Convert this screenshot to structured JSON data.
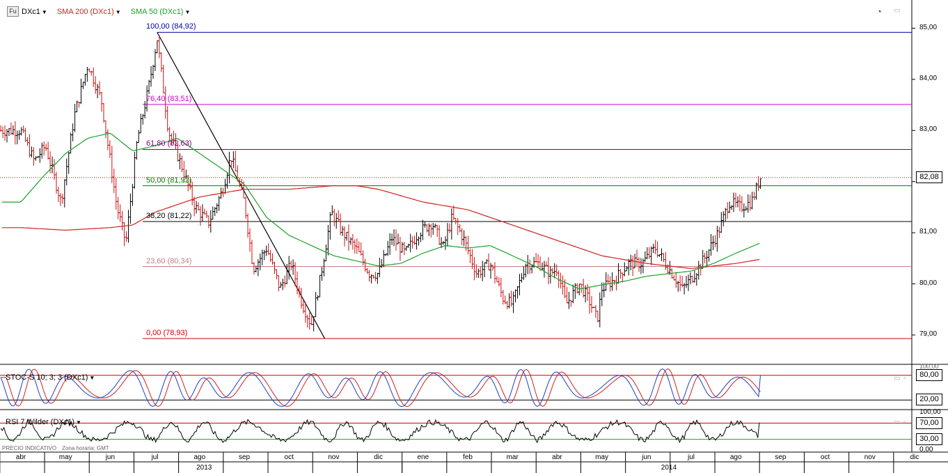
{
  "header": {
    "badge": "Fu",
    "symbol": "DXc1",
    "sma200_label": "SMA 200 (DXc1)",
    "sma50_label": "SMA 50 (DXc1)",
    "stoch_label": "STOC-S 10; 3; 3 (DXc1)",
    "rsi_label": "RSI 7 Wilder (DXc1)"
  },
  "footer_note": "PRECIO INDICATIVO",
  "footer_tz": "Zona horaria: GMT",
  "colors": {
    "sma200": "#d21f1f",
    "sma50": "#1aa12a",
    "stoch_k": "#1f3fbf",
    "stoch_d": "#d21f1f",
    "bar_up": "#000000",
    "bar_down": "#cc1010",
    "fib_100": "#0000aa",
    "fib_764": "#cc00cc",
    "fib_618": "#800080",
    "fib_500": "#007a00",
    "fib_382": "#000000",
    "fib_236": "#c48080",
    "fib_000": "#cc0000"
  },
  "chart_data": {
    "type": "ohlc",
    "symbol": "DXc1",
    "y_ticks": [
      "85,00",
      "84,00",
      "83,00",
      "82,00",
      "81,00",
      "80,00",
      "79,00"
    ],
    "y_tick_values": [
      85,
      84,
      83,
      82,
      81,
      80,
      79
    ],
    "ylim": [
      78.5,
      85.3
    ],
    "last_price": "82,08",
    "months": [
      "abr",
      "may",
      "jun",
      "jul",
      "ago",
      "sep",
      "oct",
      "nov",
      "dic",
      "ene",
      "feb",
      "mar",
      "abr",
      "may",
      "jun",
      "jul",
      "ago",
      "sep",
      "oct",
      "nov",
      "dic"
    ],
    "years": [
      "2013",
      "2014"
    ],
    "close_anchors": [
      {
        "m": 0.0,
        "v": 83.0
      },
      {
        "m": 0.3,
        "v": 82.4
      },
      {
        "m": 0.55,
        "v": 82.7
      },
      {
        "m": 0.9,
        "v": 81.6
      },
      {
        "m": 1.2,
        "v": 83.3
      },
      {
        "m": 1.5,
        "v": 84.3
      },
      {
        "m": 1.8,
        "v": 83.6
      },
      {
        "m": 2.15,
        "v": 81.5
      },
      {
        "m": 2.35,
        "v": 80.8
      },
      {
        "m": 2.6,
        "v": 82.8
      },
      {
        "m": 2.85,
        "v": 83.8
      },
      {
        "m": 3.05,
        "v": 84.8
      },
      {
        "m": 3.3,
        "v": 83.0
      },
      {
        "m": 3.6,
        "v": 82.3
      },
      {
        "m": 3.9,
        "v": 81.5
      },
      {
        "m": 4.2,
        "v": 81.2
      },
      {
        "m": 4.5,
        "v": 81.8
      },
      {
        "m": 4.7,
        "v": 82.5
      },
      {
        "m": 5.0,
        "v": 81.6
      },
      {
        "m": 5.2,
        "v": 80.3
      },
      {
        "m": 5.5,
        "v": 80.7
      },
      {
        "m": 5.8,
        "v": 79.9
      },
      {
        "m": 6.05,
        "v": 80.4
      },
      {
        "m": 6.3,
        "v": 79.6
      },
      {
        "m": 6.5,
        "v": 79.2
      },
      {
        "m": 6.7,
        "v": 80.1
      },
      {
        "m": 6.95,
        "v": 81.4
      },
      {
        "m": 7.2,
        "v": 81.0
      },
      {
        "m": 7.5,
        "v": 80.7
      },
      {
        "m": 7.8,
        "v": 80.2
      },
      {
        "m": 8.0,
        "v": 80.2
      },
      {
        "m": 8.3,
        "v": 80.9
      },
      {
        "m": 8.6,
        "v": 80.6
      },
      {
        "m": 8.9,
        "v": 81.0
      },
      {
        "m": 9.2,
        "v": 81.2
      },
      {
        "m": 9.45,
        "v": 80.7
      },
      {
        "m": 9.65,
        "v": 81.3
      },
      {
        "m": 9.9,
        "v": 80.9
      },
      {
        "m": 10.2,
        "v": 80.2
      },
      {
        "m": 10.5,
        "v": 80.4
      },
      {
        "m": 10.8,
        "v": 79.7
      },
      {
        "m": 11.0,
        "v": 79.6
      },
      {
        "m": 11.3,
        "v": 80.4
      },
      {
        "m": 11.6,
        "v": 80.4
      },
      {
        "m": 11.85,
        "v": 80.2
      },
      {
        "m": 12.0,
        "v": 80.3
      },
      {
        "m": 12.2,
        "v": 79.6
      },
      {
        "m": 12.5,
        "v": 80.0
      },
      {
        "m": 12.7,
        "v": 79.7
      },
      {
        "m": 12.9,
        "v": 79.3
      },
      {
        "m": 13.0,
        "v": 79.9
      },
      {
        "m": 13.3,
        "v": 80.1
      },
      {
        "m": 13.6,
        "v": 80.4
      },
      {
        "m": 13.9,
        "v": 80.4
      },
      {
        "m": 14.2,
        "v": 80.7
      },
      {
        "m": 14.5,
        "v": 80.3
      },
      {
        "m": 14.8,
        "v": 79.9
      },
      {
        "m": 15.0,
        "v": 80.1
      },
      {
        "m": 15.3,
        "v": 80.5
      },
      {
        "m": 15.6,
        "v": 81.0
      },
      {
        "m": 15.85,
        "v": 81.6
      },
      {
        "m": 16.1,
        "v": 81.5
      },
      {
        "m": 16.35,
        "v": 81.6
      },
      {
        "m": 16.55,
        "v": 82.08
      }
    ],
    "sma200_anchors": [
      {
        "m": 0.0,
        "v": 81.1
      },
      {
        "m": 1.0,
        "v": 81.05
      },
      {
        "m": 2.0,
        "v": 81.1
      },
      {
        "m": 2.5,
        "v": 81.15
      },
      {
        "m": 3.0,
        "v": 81.4
      },
      {
        "m": 4.0,
        "v": 81.7
      },
      {
        "m": 5.0,
        "v": 81.85
      },
      {
        "m": 6.0,
        "v": 81.85
      },
      {
        "m": 7.0,
        "v": 81.92
      },
      {
        "m": 7.5,
        "v": 81.92
      },
      {
        "m": 8.0,
        "v": 81.85
      },
      {
        "m": 9.0,
        "v": 81.6
      },
      {
        "m": 10.0,
        "v": 81.45
      },
      {
        "m": 11.0,
        "v": 81.15
      },
      {
        "m": 12.0,
        "v": 80.85
      },
      {
        "m": 13.0,
        "v": 80.55
      },
      {
        "m": 14.0,
        "v": 80.4
      },
      {
        "m": 15.0,
        "v": 80.3
      },
      {
        "m": 16.0,
        "v": 80.4
      },
      {
        "m": 16.55,
        "v": 80.48
      }
    ],
    "sma50_anchors": [
      {
        "m": 0.0,
        "v": 81.6
      },
      {
        "m": 0.5,
        "v": 82.1
      },
      {
        "m": 1.0,
        "v": 82.55
      },
      {
        "m": 1.5,
        "v": 82.85
      },
      {
        "m": 2.0,
        "v": 82.95
      },
      {
        "m": 2.5,
        "v": 82.6
      },
      {
        "m": 3.0,
        "v": 82.7
      },
      {
        "m": 3.5,
        "v": 82.85
      },
      {
        "m": 4.0,
        "v": 82.55
      },
      {
        "m": 4.5,
        "v": 82.25
      },
      {
        "m": 5.0,
        "v": 81.95
      },
      {
        "m": 5.5,
        "v": 81.3
      },
      {
        "m": 6.0,
        "v": 80.95
      },
      {
        "m": 6.5,
        "v": 80.75
      },
      {
        "m": 7.0,
        "v": 80.55
      },
      {
        "m": 7.5,
        "v": 80.45
      },
      {
        "m": 8.0,
        "v": 80.35
      },
      {
        "m": 8.5,
        "v": 80.4
      },
      {
        "m": 9.0,
        "v": 80.6
      },
      {
        "m": 9.5,
        "v": 80.75
      },
      {
        "m": 10.0,
        "v": 80.7
      },
      {
        "m": 10.5,
        "v": 80.75
      },
      {
        "m": 11.0,
        "v": 80.55
      },
      {
        "m": 11.5,
        "v": 80.35
      },
      {
        "m": 12.0,
        "v": 80.1
      },
      {
        "m": 12.5,
        "v": 79.9
      },
      {
        "m": 13.0,
        "v": 79.98
      },
      {
        "m": 13.5,
        "v": 80.05
      },
      {
        "m": 14.0,
        "v": 80.15
      },
      {
        "m": 14.5,
        "v": 80.2
      },
      {
        "m": 15.0,
        "v": 80.25
      },
      {
        "m": 15.5,
        "v": 80.4
      },
      {
        "m": 16.0,
        "v": 80.6
      },
      {
        "m": 16.55,
        "v": 80.8
      }
    ],
    "fibonacci": [
      {
        "level": 100.0,
        "label": "100,00 (84,92)",
        "value": 84.92,
        "color_key": "fib_100"
      },
      {
        "level": 76.4,
        "label": "76,40 (83,51)",
        "value": 83.51,
        "color_key": "fib_764"
      },
      {
        "level": 61.8,
        "label": "61,80 (82,63)",
        "value": 82.63,
        "color_key": "fib_618"
      },
      {
        "level": 50.0,
        "label": "50,00 (81,92)",
        "value": 81.92,
        "color_key": "fib_500"
      },
      {
        "level": 38.2,
        "label": "38,20 (81,22)",
        "value": 81.22,
        "color_key": "fib_382"
      },
      {
        "level": 23.6,
        "label": "23,60 (80,34)",
        "value": 80.34,
        "color_key": "fib_236"
      },
      {
        "level": 0.0,
        "label": "0,00 (78,93)",
        "value": 78.93,
        "color_key": "fib_000"
      }
    ],
    "trendline": {
      "from": {
        "m": 3.05,
        "v": 84.92
      },
      "to": {
        "m": 6.8,
        "v": 78.93
      }
    },
    "stochastic": {
      "ylim": [
        0,
        100
      ],
      "levels": [
        80,
        20
      ],
      "level_labels": [
        "80,00",
        "20,00"
      ],
      "axis_top": "100,00",
      "last_value": 80
    },
    "rsi": {
      "ylim": [
        0,
        100
      ],
      "levels": [
        70,
        30
      ],
      "level_labels": [
        "70,00",
        "30,00"
      ],
      "axis_top": "100,00",
      "axis_bottom": "0,00",
      "last_value": 71
    }
  }
}
